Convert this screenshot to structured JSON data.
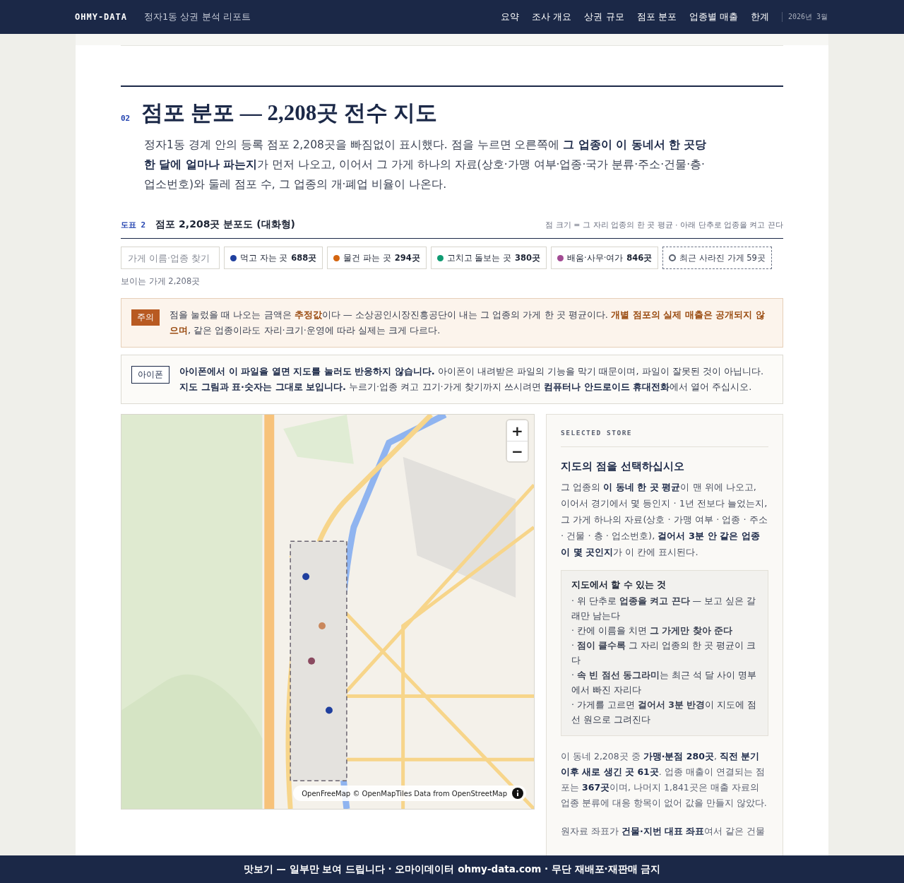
{
  "header": {
    "brand": "OHMY-DATA",
    "report_title": "정자1동 상권 분석 리포트",
    "nav": [
      "요약",
      "조사 개요",
      "상권 규모",
      "점포 분포",
      "업종별 매출",
      "한계"
    ],
    "date": "2026년 3월"
  },
  "section": {
    "number": "02",
    "title": "점포 분포 — 2,208곳 전수 지도",
    "intro": "정자1동 경계 안의 등록 점포 2,208곳을 빠짐없이 표시했다. 점을 누르면 오른쪽에 **그 업종이 이 동네서 한 곳당 한 달에 얼마나 파는지**가 먼저 나오고, 이어서 그 가게 하나의 자료(상호·가맹 여부·업종·국가 분류·주소·건물·층·업소번호)와 둘레 점포 수, 그 업종의 개·폐업 비율이 나온다."
  },
  "figure": {
    "label": "도표 2",
    "title": "점포 2,208곳 분포도 (대화형)",
    "note": "점 크기 = 그 자리 업종의 한 곳 평균 · 아래 단추로 업종을 켜고 끈다"
  },
  "controls": {
    "search": {
      "placeholder": "가게 이름·업종 찾기"
    },
    "filters": [
      {
        "kind": "category",
        "label": "먹고 자는 곳",
        "count": "688곳",
        "color": "#1f3f9e"
      },
      {
        "kind": "category",
        "label": "물건 파는 곳",
        "count": "294곳",
        "color": "#d4650f"
      },
      {
        "kind": "category",
        "label": "고치고 돌보는 곳",
        "count": "380곳",
        "color": "#0f9b72"
      },
      {
        "kind": "category",
        "label": "배움·사무·여가",
        "count": "846곳",
        "color": "#a24a93"
      },
      {
        "kind": "closed",
        "label": "최근 사라진 가게",
        "count": "59곳",
        "color": "#5a6270"
      }
    ],
    "visible": "보이는 가게 2,208곳"
  },
  "notices": [
    {
      "kind": "caution",
      "tag": "주의",
      "text": "점을 눌렀을 때 나오는 금액은 **추정값**이다 — 소상공인시장진흥공단이 내는 그 업종의 가게 한 곳 평균이다. **개별 점포의 실제 매출은 공개되지 않으며**, 같은 업종이라도 자리·크기·운영에 따라 실제는 크게 다르다."
    },
    {
      "kind": "info",
      "tag": "아이폰",
      "text": "**아이폰에서 이 파일을 열면 지도를 눌러도 반응하지 않습니다.** 아이폰이 내려받은 파일의 기능을 막기 때문이며, 파일이 잘못된 것이 아닙니다. **지도 그림과 표·숫자는 그대로 보입니다.** 누르기·업종 켜고 끄기·가게 찾기까지 쓰시려면 **컴퓨터나 안드로이드 휴대전화**에서 열어 주십시오."
    }
  ],
  "map": {
    "kind": "picture",
    "zoom_in": "+",
    "zoom_out": "−",
    "attribution": "OpenFreeMap © OpenMapTiles Data from OpenStreetMap"
  },
  "panel": {
    "eyebrow": "SELECTED STORE",
    "heading": "지도의 점을 선택하십시오",
    "description": "그 업종의 **이 동네 한 곳 평균**이 맨 위에 나오고, 이어서 경기에서 몇 등인지 · 1년 전보다 늘었는지, 그 가게 하나의 자료(상호 · 가맹 여부 · 업종 · 주소 · 건물 · 층 · 업소번호), **걸어서 3분 안 같은 업종이 몇 곳인지**가 이 칸에 표시된다.",
    "tips": {
      "title": "지도에서 할 수 있는 것",
      "items": [
        "· 위 단추로 **업종을 켜고 끈다** — 보고 싶은 갈래만 남는다",
        "· 칸에 이름을 치면 **그 가게만 찾아 준다**",
        "· **점이 클수록** 그 자리 업종의 한 곳 평균이 크다",
        "· **속 빈 점선 동그라미**는 최근 석 달 사이 명부에서 빠진 자리다",
        "· 가게를 고르면 **걸어서 3분 반경**이 지도에 점선 원으로 그려진다"
      ]
    },
    "paragraphs": [
      "이 동네 2,208곳 중 **가맹·분점 280곳**, **직전 분기 이후 새로 생긴 곳 61곳**. 업종 매출이 연결되는 점포는 **367곳**이며, 나머지 1,841곳은 매출 자료의 업종 분류에 대응 항목이 없어 값을 만들지 않았다.",
      "원자료 좌표가 **건물·지번 대표 좌표**여서 같은 건물"
    ]
  },
  "footer": {
    "text": "맛보기 — 일부만 보여 드립니다 · 오마이데이터 ohmy-data.com · 무단 재배포·재판매 금지"
  }
}
